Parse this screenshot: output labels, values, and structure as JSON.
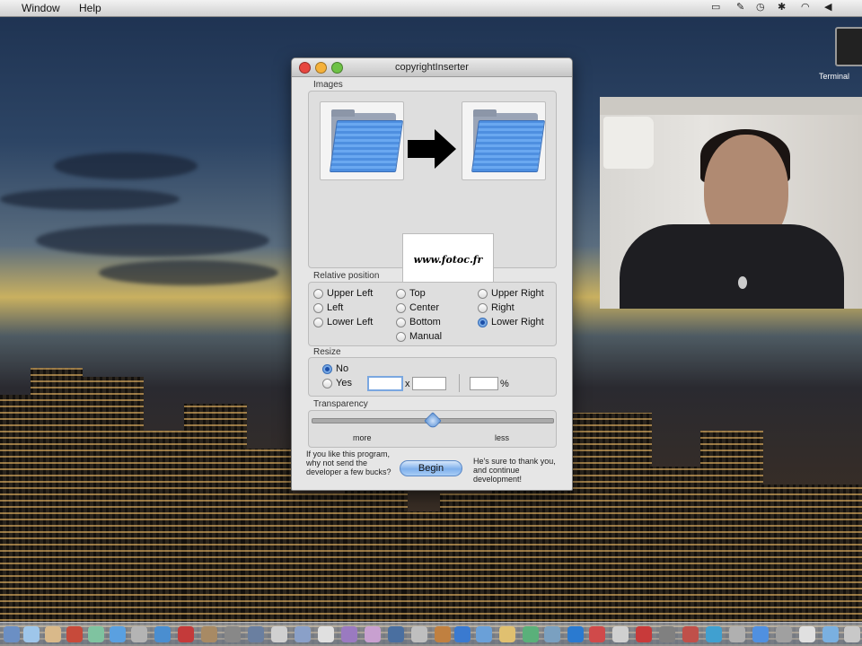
{
  "menubar": {
    "items": [
      "Window",
      "Help"
    ]
  },
  "desktop": {
    "terminal_label": "Terminal"
  },
  "window": {
    "title": "copyrightInserter",
    "images": {
      "label": "Images",
      "watermark_text": "www.fotoc.fr"
    },
    "relative_position": {
      "label": "Relative position",
      "options": [
        "Upper Left",
        "Left",
        "Lower Left",
        "Top",
        "Center",
        "Bottom",
        "Manual",
        "Upper Right",
        "Right",
        "Lower Right"
      ],
      "selected": "Lower Right"
    },
    "resize": {
      "label": "Resize",
      "no_label": "No",
      "yes_label": "Yes",
      "selected": "No",
      "x_separator": "x",
      "percent_symbol": "%"
    },
    "transparency": {
      "label": "Transparency",
      "min_label": "more",
      "max_label": "less",
      "level": 0.5
    },
    "footer": {
      "left_text": "If you like this program, why not send the developer a few bucks?",
      "begin_label": "Begin",
      "right_text": "He's sure to thank you, and continue development!"
    }
  },
  "colors": {
    "accent": "#5b93d8",
    "window_bg": "#e6e6e6"
  }
}
